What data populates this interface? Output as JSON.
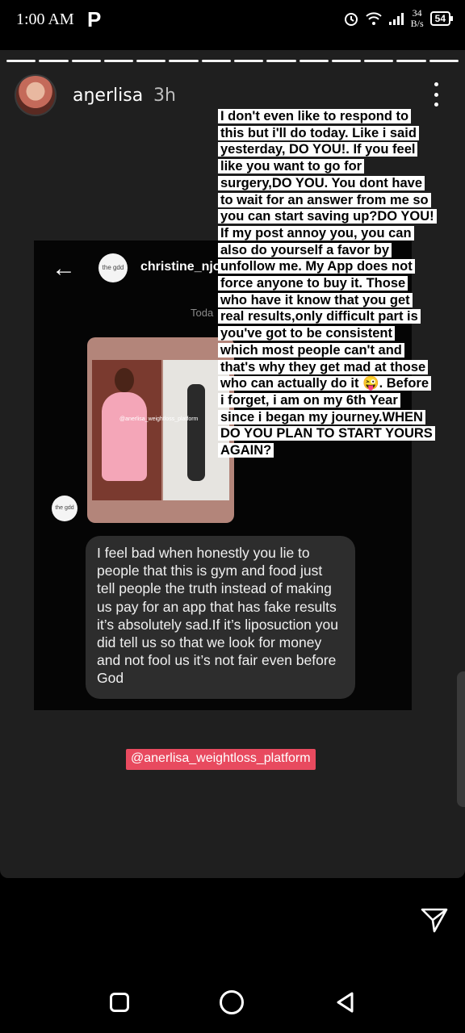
{
  "status_bar": {
    "time": "1:00 AM",
    "app_icon": "P",
    "speed_value": "34",
    "speed_unit": "B/s",
    "battery": "54",
    "icons": [
      "alarm-icon",
      "wifi-icon",
      "signal-icon",
      "battery-icon"
    ]
  },
  "story": {
    "username": "aŋerlisa",
    "time_ago": "3h",
    "progress_segments": 14,
    "caption_lines": [
      "I don't even like to respond to",
      "this but i'll do today. Like i said",
      "yesterday, DO YOU!. If you feel",
      "like you want to go for",
      "surgery,DO YOU. You dont have",
      "to wait for an answer from me so",
      "you can start saving up?DO YOU!",
      "If my post annoy you, you can",
      "also do yourself a favor by",
      "unfollow me. My App does not",
      "force anyone to buy it. Those",
      "who have it know that you get",
      "real results,only difficult part is",
      "you've got to be consistent",
      "which most people can't and",
      "that's why they get mad at those",
      "who can actually do it 😜. Before",
      "i forget, i am on my 6th Year",
      "since i began my journey.WHEN",
      "DO YOU PLAN TO START YOURS",
      "AGAIN?"
    ],
    "mention": "@anerlisa_weightloss_platform"
  },
  "embedded_dm": {
    "contact_name": "christine_njo",
    "date_label": "Toda",
    "media_tag": "@anerlisa_weightloss_platform",
    "avatar_label": "the gdd",
    "message": "I feel bad when honestly you lie to people that this is gym and food just tell people the truth instead of making us pay for an app that has fake results it’s absolutely sad.If it’s liposuction you did tell us so that we look for money and not fool us it’s not fair even before God"
  },
  "colors": {
    "story_bg": "#1f1f1f",
    "mention_bg": "#e84a5f",
    "bubble_bg": "#2d2d2d"
  }
}
